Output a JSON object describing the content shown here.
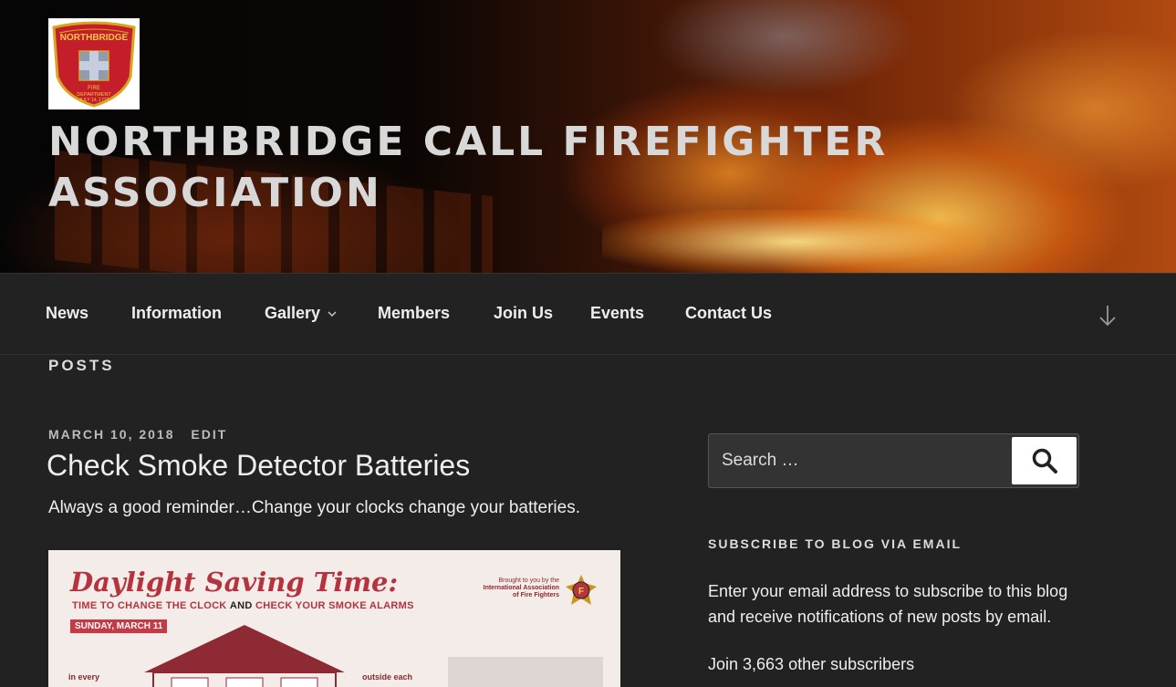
{
  "header": {
    "site_title": "NORTHBRIDGE CALL FIREFIGHTER ASSOCIATION",
    "logo": {
      "top_text": "NORTHBRIDGE",
      "middle_text": "FIRE",
      "bottom_text": "DEPARTMENT",
      "date_text": "JULY 14, 1772"
    }
  },
  "nav": {
    "items": [
      {
        "label": "News"
      },
      {
        "label": "Information"
      },
      {
        "label": "Gallery",
        "has_dropdown": true
      },
      {
        "label": "Members"
      },
      {
        "label": "Join Us"
      },
      {
        "label": "Events"
      },
      {
        "label": "Contact Us"
      }
    ],
    "scroll_icon": "arrow-down-icon"
  },
  "main": {
    "section_heading": "Posts",
    "post": {
      "date": "March 10, 2018",
      "edit_label": "Edit",
      "title": "Check Smoke Detector Batteries",
      "excerpt": "Always a good reminder…Change your clocks change your batteries.",
      "image": {
        "title": "Daylight Saving Time:",
        "subtitle_pre": "TIME TO CHANGE THE CLOCK ",
        "subtitle_bold": "AND",
        "subtitle_post": " CHECK YOUR SMOKE ALARMS",
        "date_badge": "SUNDAY, MARCH 11",
        "brought_line1": "Brought to you by the",
        "brought_line2": "International Association",
        "brought_line3": "of Fire Fighters",
        "left_caption": "in every",
        "right_caption": "outside each"
      }
    }
  },
  "sidebar": {
    "search": {
      "placeholder": "Search …",
      "button_icon": "search-icon"
    },
    "subscribe": {
      "heading": "Subscribe to Blog via Email",
      "text": "Enter your email address to subscribe to this blog and receive notifications of new posts by email.",
      "count": "Join 3,663 other subscribers"
    }
  },
  "colors": {
    "background": "#222222",
    "accent_red": "#b5333f",
    "text": "#eeeeee"
  }
}
